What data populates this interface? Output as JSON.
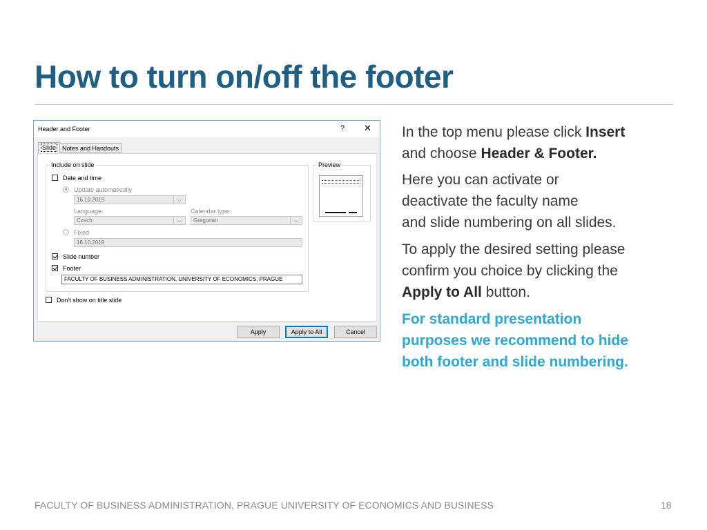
{
  "slide": {
    "title": "How to turn on/off the footer",
    "footer_text": "FACULTY OF BUSINESS ADMINISTRATION, PRAGUE UNIVERSITY OF ECONOMICS AND BUSINESS",
    "page_number": "18"
  },
  "dialog": {
    "title": "Header and Footer",
    "help": "?",
    "close": "✕",
    "tabs": [
      {
        "label": "Slide",
        "active": true
      },
      {
        "label": "Notes and Handouts",
        "active": false
      }
    ],
    "include_group_label": "Include on slide",
    "date_and_time": {
      "label": "Date and time",
      "checked": false
    },
    "update_automatically": {
      "label": "Update automatically",
      "selected": true
    },
    "auto_date_value": "16.10.2019",
    "language_label": "Language:",
    "language_value": "Czech",
    "calendar_type_label": "Calendar type:",
    "calendar_type_value": "Gregorian",
    "fixed": {
      "label": "Fixed",
      "selected": false
    },
    "fixed_date_value": "16.10.2019",
    "slide_number": {
      "label": "Slide number",
      "checked": true
    },
    "footer": {
      "label": "Footer",
      "checked": true
    },
    "footer_value": "FACULTY OF BUSINESS ADMINISTRATION, UNIVERSITY OF ECONOMICS, PRAGUE",
    "dont_show_title": {
      "label": "Don't show on title slide",
      "checked": false
    },
    "preview_label": "Preview",
    "buttons": {
      "apply": "Apply",
      "apply_to_all": "Apply to All",
      "cancel": "Cancel"
    }
  },
  "instructions": {
    "p1_a": "In the top menu please click ",
    "p1_b": "Insert",
    "p1_c": "and choose ",
    "p1_d": "Header & Footer.",
    "p2_l1": "Here you can activate or",
    "p2_l2": "deactivate the faculty name",
    "p2_l3": "and slide numbering on all slides.",
    "p3_l1": "To apply the desired setting please",
    "p3_l2": "confirm you choice by clicking the",
    "p3_b": "Apply to All",
    "p3_c": " button.",
    "rec_l1": "For standard presentation",
    "rec_l2": "purposes we recommend to hide",
    "rec_l3": "both footer and slide numbering."
  },
  "colors": {
    "title": "#1f5f86",
    "highlight": "#2aa8d8",
    "dialog_border": "#7aa7c7",
    "default_button": "#0078d7"
  }
}
